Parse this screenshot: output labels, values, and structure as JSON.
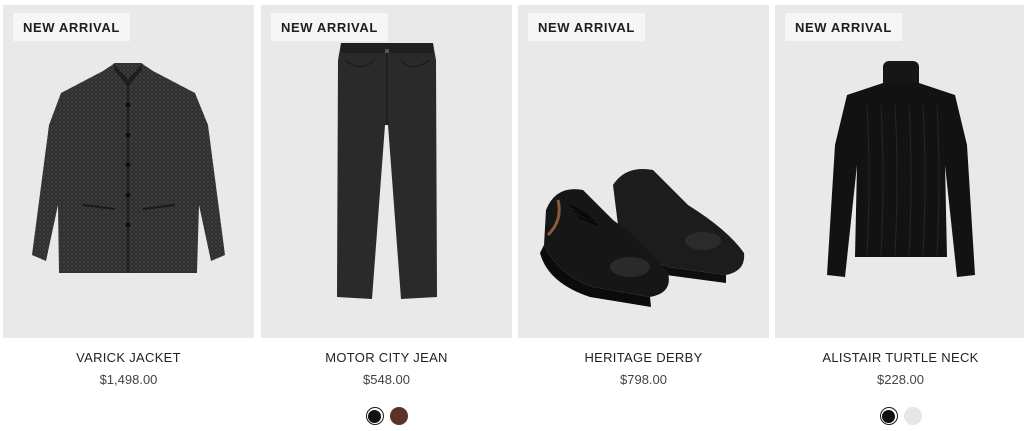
{
  "products": [
    {
      "badge": "NEW ARRIVAL",
      "name": "VARICK JACKET",
      "price": "$1,498.00",
      "swatches": []
    },
    {
      "badge": "NEW ARRIVAL",
      "name": "MOTOR CITY JEAN",
      "price": "$548.00",
      "swatches": [
        {
          "color": "#111111",
          "selected": true
        },
        {
          "color": "#5a3326",
          "selected": false
        }
      ]
    },
    {
      "badge": "NEW ARRIVAL",
      "name": "HERITAGE DERBY",
      "price": "$798.00",
      "swatches": []
    },
    {
      "badge": "NEW ARRIVAL",
      "name": "ALISTAIR TURTLE NECK",
      "price": "$228.00",
      "swatches": [
        {
          "color": "#111111",
          "selected": true
        },
        {
          "color": "#e6e6e6",
          "selected": false
        }
      ]
    }
  ],
  "colors": {
    "tile_background": "#e9e9e9",
    "badge_background": "#f6f6f6",
    "text": "#222222"
  }
}
